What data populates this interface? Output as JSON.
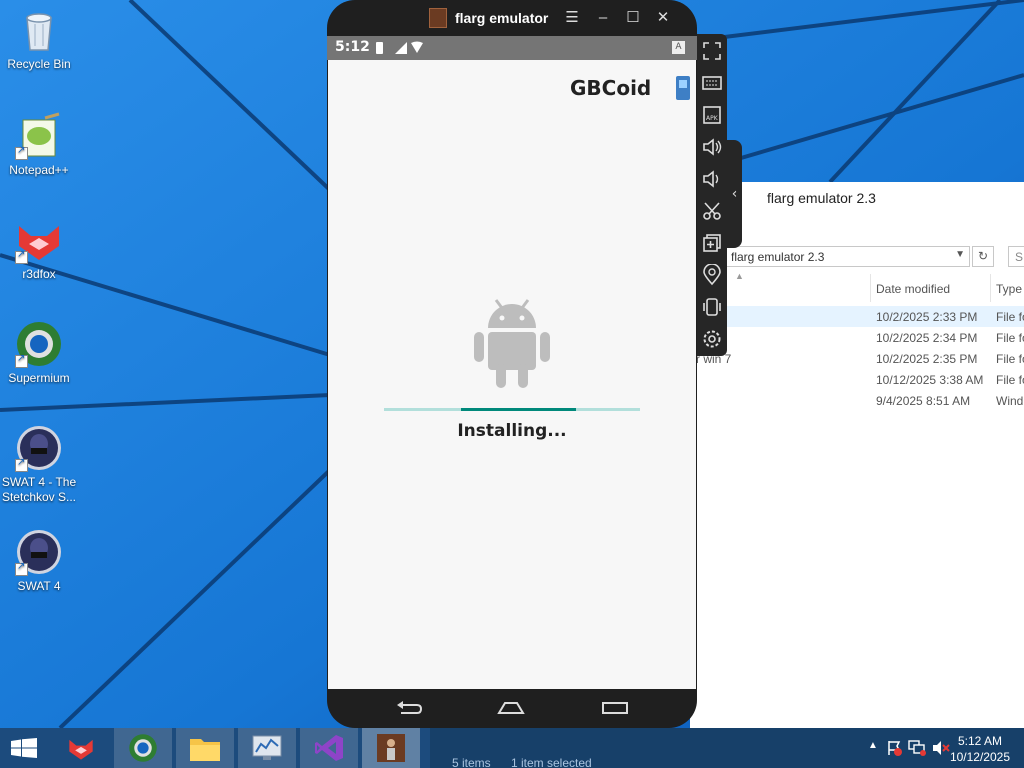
{
  "desktop": {
    "icons": [
      {
        "label": "Recycle Bin",
        "icon": "recycle-bin-icon"
      },
      {
        "label": "Notepad++",
        "icon": "notepad-plus-plus-icon"
      },
      {
        "label": "r3dfox",
        "icon": "r3dfox-icon"
      },
      {
        "label": "Supermium",
        "icon": "supermium-icon"
      },
      {
        "label": "SWAT 4 - The Stetchkov S...",
        "icon": "swat4-stetchkov-icon"
      },
      {
        "label": "SWAT 4",
        "icon": "swat4-icon"
      }
    ]
  },
  "emulator": {
    "title": "flarg emulator",
    "status_time": "5:12",
    "app_title": "GBCoid",
    "install_label": "Installing...",
    "progress_fraction": 0.3,
    "progress_offset": 0.3
  },
  "explorer": {
    "title": "flarg emulator 2.3",
    "address": "flarg emulator 2.3",
    "search_placeholder": "S",
    "columns": {
      "date": "Date modified",
      "type": "Type"
    },
    "rows": [
      {
        "name": "",
        "date": "10/2/2025 2:33 PM",
        "type": "File fo",
        "selected": true
      },
      {
        "name": "",
        "date": "10/2/2025 2:34 PM",
        "type": "File fo",
        "selected": false
      },
      {
        "name": "r win 7",
        "date": "10/2/2025 2:35 PM",
        "type": "File fo",
        "selected": false
      },
      {
        "name": "",
        "date": "10/12/2025 3:38 AM",
        "type": "File fo",
        "selected": false
      },
      {
        "name": "",
        "date": "9/4/2025 8:51 AM",
        "type": "Wind",
        "selected": false
      }
    ],
    "status_items": "5 items",
    "status_selected": "1 item selected"
  },
  "taskbar": {
    "time": "5:12 AM",
    "date": "10/12/2025"
  },
  "colors": {
    "wallpaper": "#1a78d6",
    "accent_teal": "#00897b",
    "taskbar": "#1c4b7d"
  }
}
